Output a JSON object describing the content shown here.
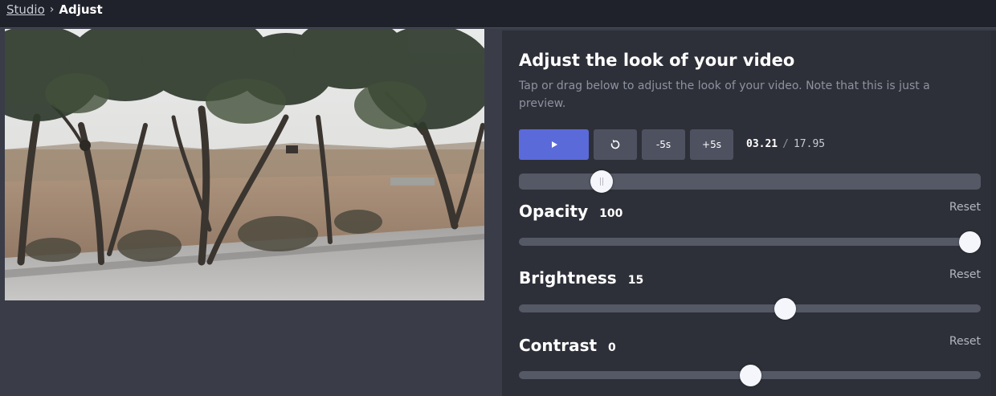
{
  "breadcrumb": {
    "root": "Studio",
    "separator": "›",
    "current": "Adjust"
  },
  "panel": {
    "title": "Adjust the look of your video",
    "description": "Tap or drag below to adjust the look of your video. Note that this is just a preview."
  },
  "playback": {
    "play_icon": "play-icon",
    "restart_icon": "restart-icon",
    "back_label": "-5s",
    "forward_label": "+5s",
    "current_time": "03.21",
    "time_separator": "/",
    "total_time": "17.95",
    "progress_fraction": 0.179
  },
  "controls": [
    {
      "label": "Opacity",
      "value": "100",
      "reset_label": "Reset",
      "fraction": 1.0
    },
    {
      "label": "Brightness",
      "value": "15",
      "reset_label": "Reset",
      "fraction": 0.575
    },
    {
      "label": "Contrast",
      "value": "0",
      "reset_label": "Reset",
      "fraction": 0.5
    }
  ],
  "colors": {
    "accent": "#5b6ad9",
    "panel_bg": "#2e3039",
    "page_bg": "#3a3d48",
    "topbar_bg": "#1f222b"
  }
}
